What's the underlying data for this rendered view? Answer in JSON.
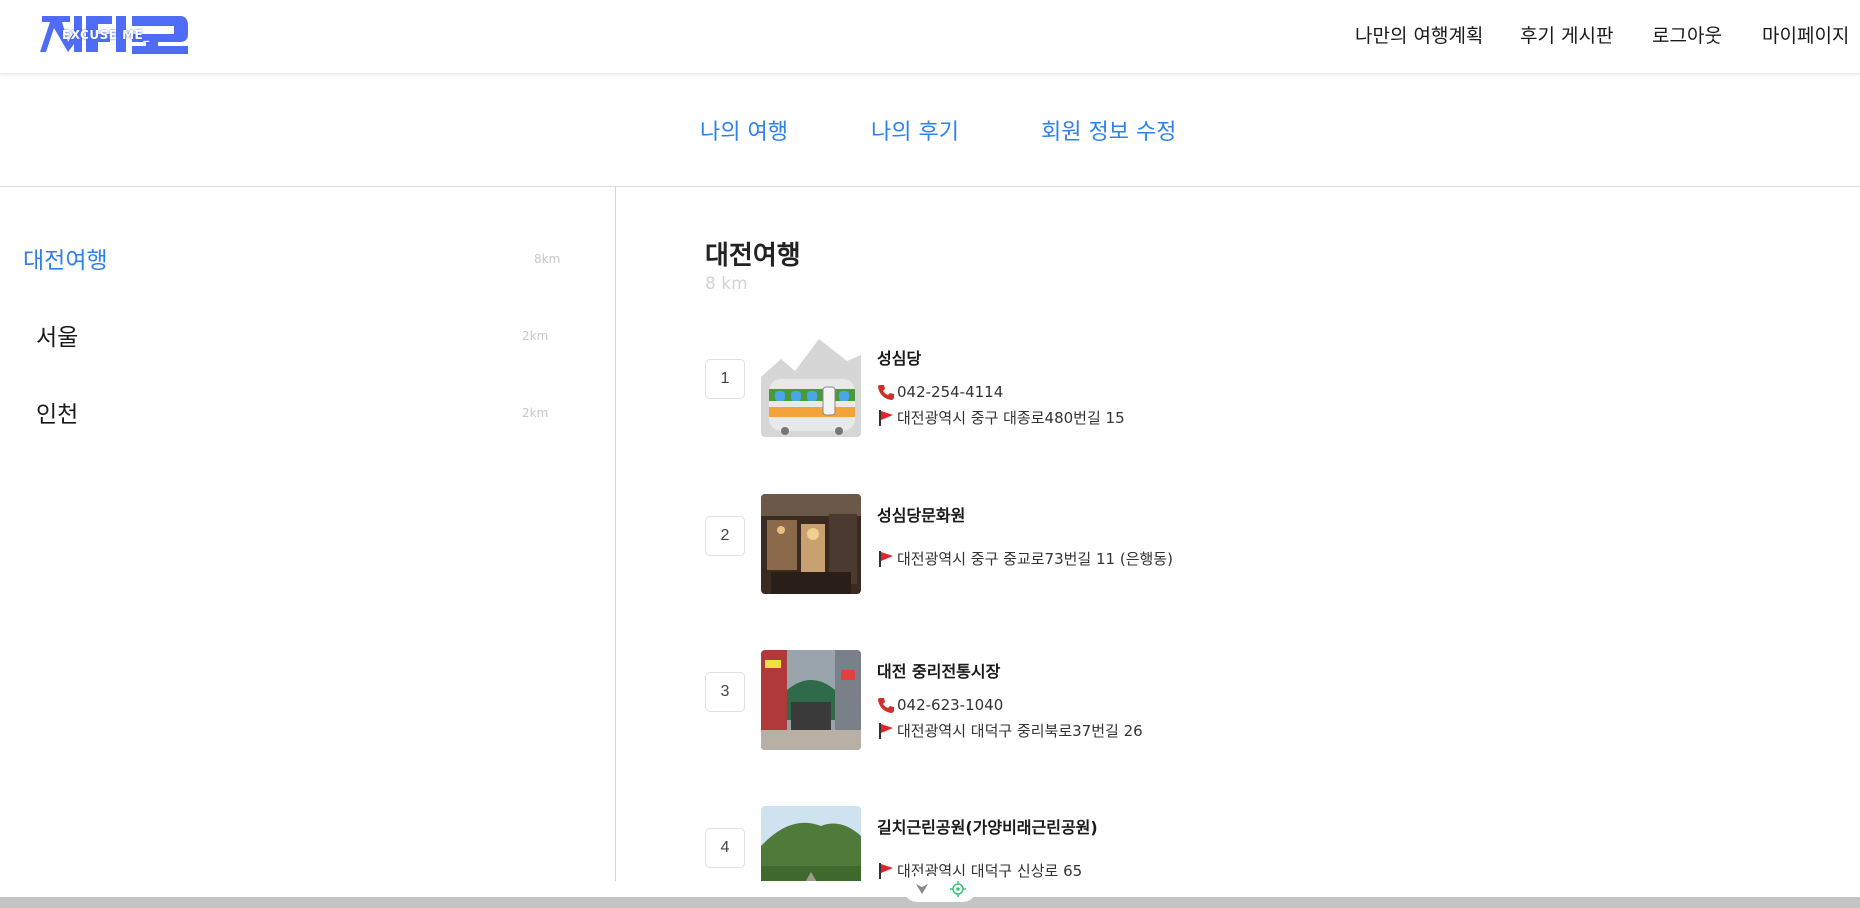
{
  "brand": {
    "logo_text": "EXCUSE ME_",
    "accent_color": "#4e6cf5"
  },
  "top_nav": {
    "items": [
      "나만의 여행계획",
      "후기 게시판",
      "로그아웃",
      "마이페이지"
    ]
  },
  "sub_tabs": [
    "나의 여행",
    "나의 후기",
    "회원 정보 수정"
  ],
  "sidebar": {
    "trips": [
      {
        "name": "대전여행",
        "distance": "8km",
        "active": true
      },
      {
        "name": "서울",
        "distance": "2km",
        "active": false
      },
      {
        "name": "인천",
        "distance": "2km",
        "active": false
      }
    ]
  },
  "main": {
    "title": "대전여행",
    "distance": "8 km",
    "places": [
      {
        "num": "1",
        "name": "성심당",
        "phone": "042-254-4114",
        "address": "대전광역시 중구 대종로480번길 15",
        "thumb": "train-illustration"
      },
      {
        "num": "2",
        "name": "성심당문화원",
        "phone": "",
        "address": "대전광역시 중구 중교로73번길 11 (은행동)",
        "thumb": "shop-photo"
      },
      {
        "num": "3",
        "name": "대전 중리전통시장",
        "phone": "042-623-1040",
        "address": "대전광역시 대덕구 중리북로37번길 26",
        "thumb": "market-photo"
      },
      {
        "num": "4",
        "name": "길치근린공원(가양비래근린공원)",
        "phone": "",
        "address": "대전광역시 대덕구 신상로 65",
        "thumb": "park-photo"
      }
    ]
  },
  "icons": {
    "phone": "phone-icon",
    "address": "red-flag-icon"
  },
  "colors": {
    "link_blue": "#2f80ed",
    "muted_gray": "#c8c8c8",
    "bottom_bar": "#c4c4c4"
  }
}
